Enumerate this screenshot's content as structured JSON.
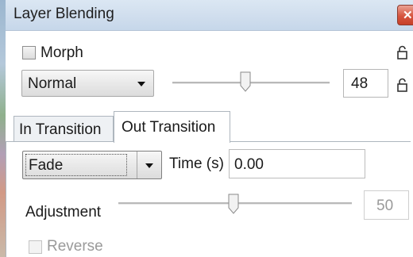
{
  "window": {
    "title": "Layer Blending",
    "close_icon": "close-icon"
  },
  "morph": {
    "label": "Morph",
    "checked": false,
    "lock_icon": "lock-icon"
  },
  "blend_mode": {
    "selected": "Normal"
  },
  "opacity": {
    "value": "48",
    "slider_fraction": 0.48
  },
  "tabs": [
    {
      "label": "In Transition",
      "active": false
    },
    {
      "label": "Out Transition",
      "active": true
    }
  ],
  "transition": {
    "type": "Fade",
    "time_label": "Time (s)",
    "time_value": "0.00"
  },
  "adjustment": {
    "label": "Adjustment",
    "value": "50",
    "slider_fraction": 0.5
  },
  "reverse": {
    "label": "Reverse",
    "checked": false,
    "enabled": false
  },
  "colors": {
    "titlebar": "#cfdded",
    "close": "#d6553f",
    "tab_border": "#aeb6be",
    "disabled_text": "#9a9a9a"
  }
}
